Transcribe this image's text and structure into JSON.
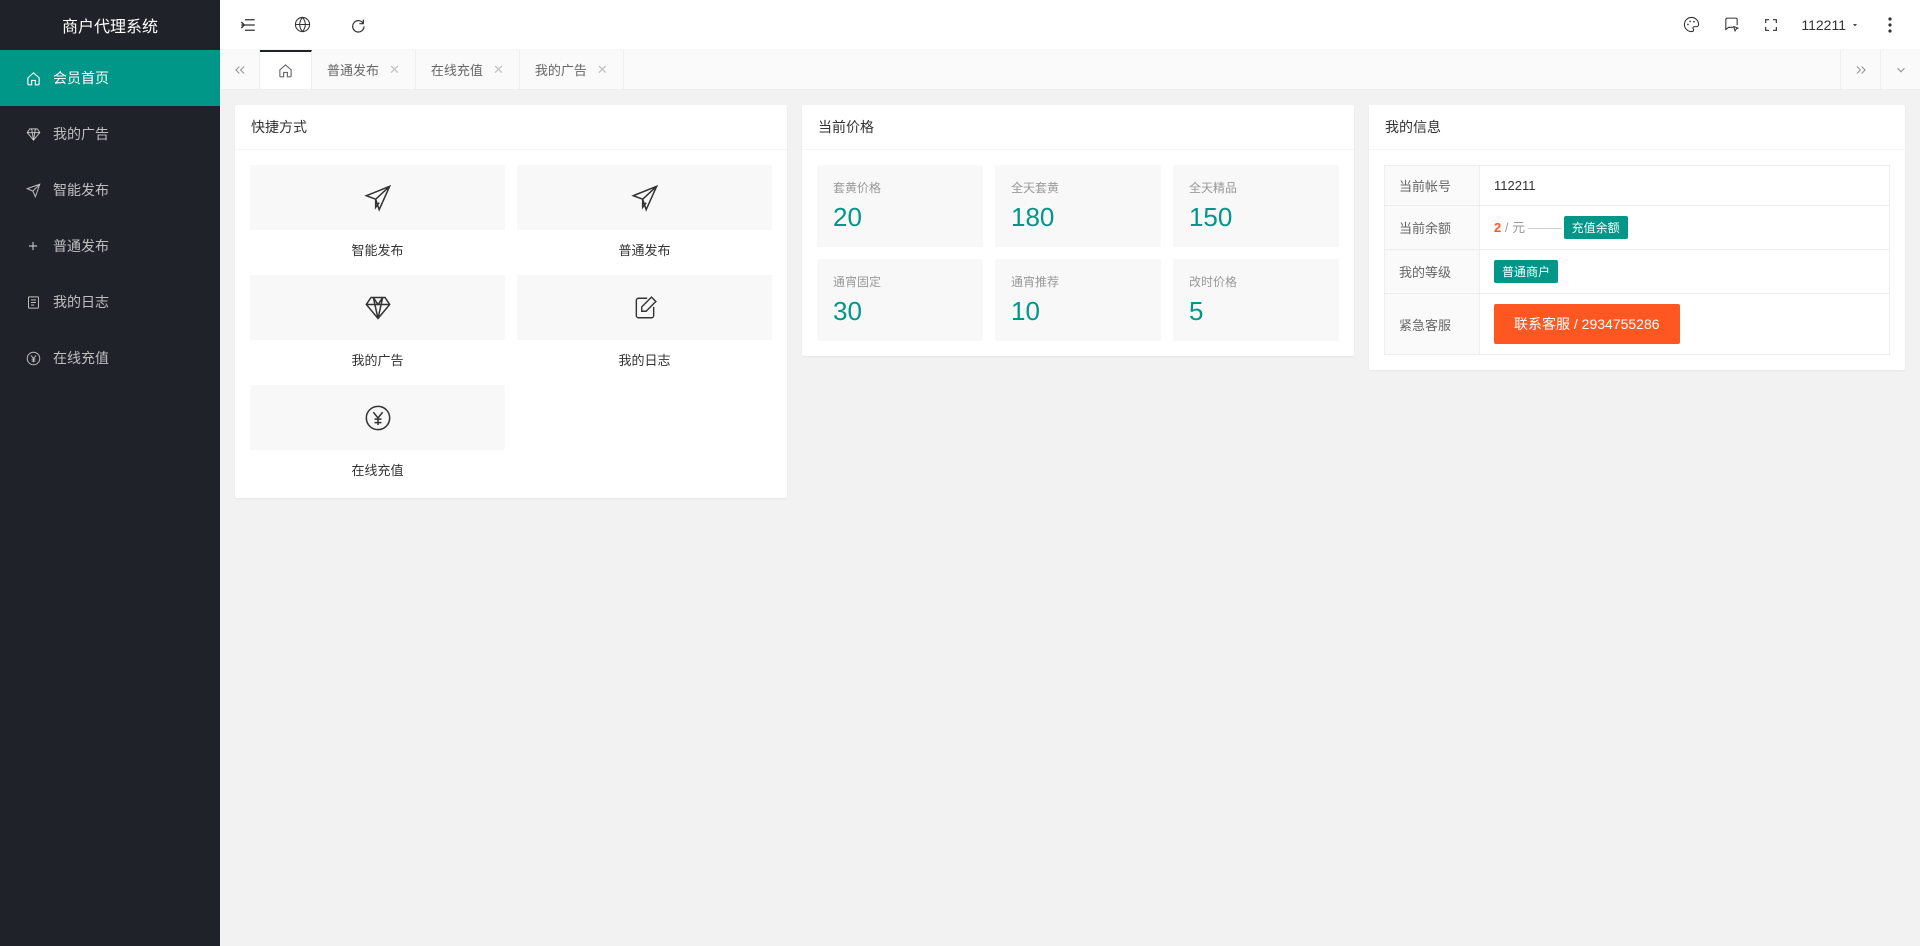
{
  "app_title": "商户代理系统",
  "sidebar": {
    "items": [
      {
        "label": "会员首页"
      },
      {
        "label": "我的广告"
      },
      {
        "label": "智能发布"
      },
      {
        "label": "普通发布"
      },
      {
        "label": "我的日志"
      },
      {
        "label": "在线充值"
      }
    ]
  },
  "topbar": {
    "username": "112211"
  },
  "tabs": {
    "items": [
      {
        "label": "普通发布"
      },
      {
        "label": "在线充值"
      },
      {
        "label": "我的广告"
      }
    ]
  },
  "shortcuts": {
    "title": "快捷方式",
    "items": [
      {
        "label": "智能发布"
      },
      {
        "label": "普通发布"
      },
      {
        "label": "我的广告"
      },
      {
        "label": "我的日志"
      },
      {
        "label": "在线充值"
      }
    ]
  },
  "prices": {
    "title": "当前价格",
    "items": [
      {
        "label": "套黄价格",
        "value": "20"
      },
      {
        "label": "全天套黄",
        "value": "180"
      },
      {
        "label": "全天精品",
        "value": "150"
      },
      {
        "label": "通宵固定",
        "value": "30"
      },
      {
        "label": "通宵推荐",
        "value": "10"
      },
      {
        "label": "改时价格",
        "value": "5"
      }
    ]
  },
  "info": {
    "title": "我的信息",
    "account_label": "当前帐号",
    "account_value": "112211",
    "balance_label": "当前余额",
    "balance_value": "2",
    "balance_unit": " / 元",
    "balance_dashes": " ---------- ",
    "recharge_btn": "充值余额",
    "level_label": "我的等级",
    "level_value": "普通商户",
    "contact_label": "紧急客服",
    "contact_btn": "联系客服 / 2934755286"
  }
}
